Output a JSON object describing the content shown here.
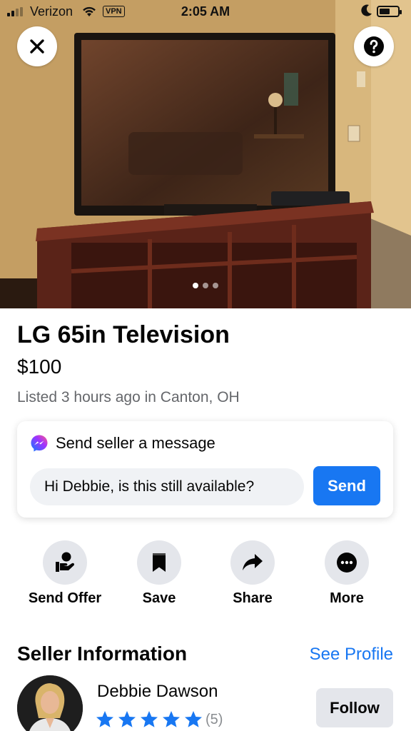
{
  "status_bar": {
    "carrier": "Verizon",
    "vpn": "VPN",
    "time": "2:05 AM"
  },
  "listing": {
    "title": "LG 65in Television",
    "price": "$100",
    "meta": "Listed 3 hours ago in Canton, OH",
    "photo_count": 3,
    "active_photo": 1
  },
  "message_card": {
    "heading": "Send seller a message",
    "input_value": "Hi Debbie, is this still available?",
    "send_label": "Send"
  },
  "actions": [
    {
      "label": "Send Offer",
      "icon": "send-offer-icon"
    },
    {
      "label": "Save",
      "icon": "bookmark-icon"
    },
    {
      "label": "Share",
      "icon": "share-icon"
    },
    {
      "label": "More",
      "icon": "more-icon"
    }
  ],
  "seller": {
    "heading": "Seller Information",
    "see_profile": "See Profile",
    "name": "Debbie Dawson",
    "rating_stars": 5,
    "rating_count": "(5)",
    "follow_label": "Follow"
  },
  "colors": {
    "accent": "#1877f2",
    "secondary_text": "#65676b",
    "button_gray": "#e4e6eb"
  }
}
